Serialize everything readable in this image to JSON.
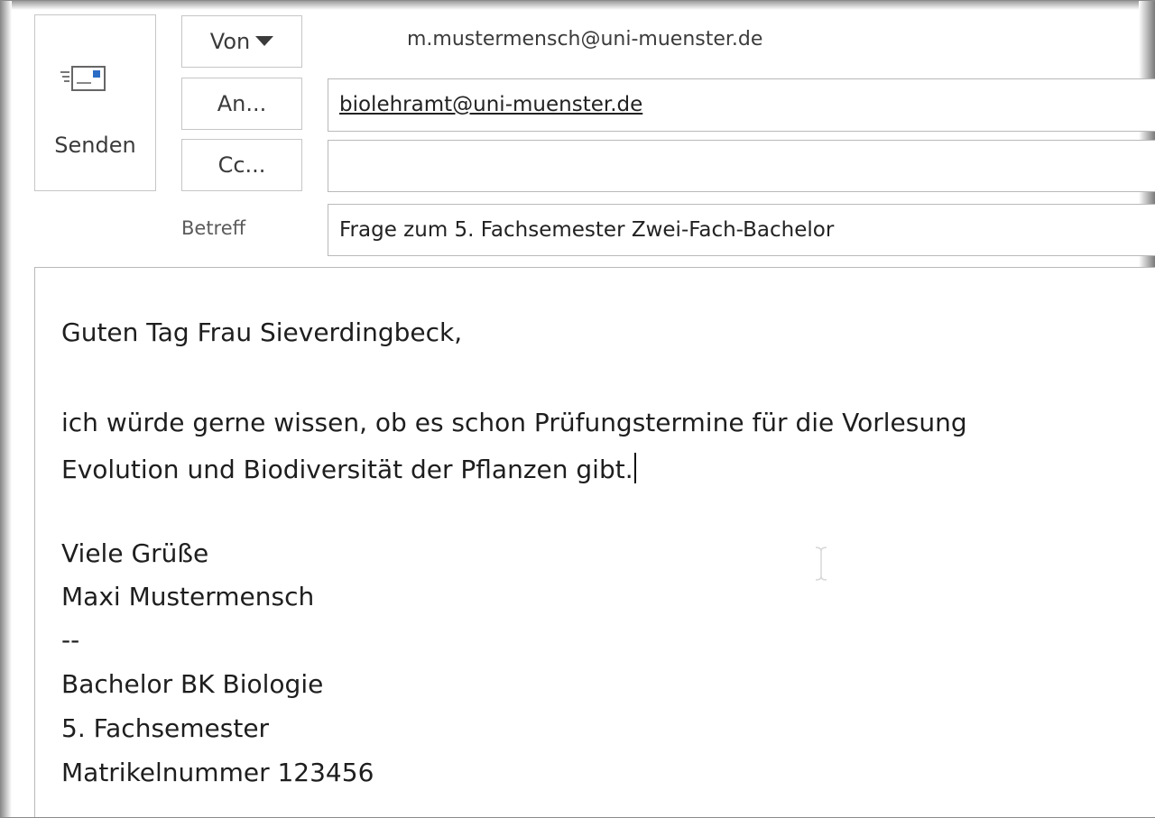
{
  "header": {
    "send_label": "Senden",
    "from_label": "Von",
    "to_label": "An...",
    "cc_label": "Cc...",
    "subject_label": "Betreff",
    "from_address": "m.mustermensch@uni-muenster.de",
    "to_address": "biolehramt@uni-muenster.de",
    "cc_value": "",
    "subject": "Frage zum 5. Fachsemester Zwei-Fach-Bachelor"
  },
  "body": {
    "lines": [
      "Guten Tag Frau Sieverdingbeck,",
      "ich würde gerne wissen, ob es schon Prüfungstermine für die Vorlesung",
      "Evolution und Biodiversität der Pflanzen gibt.",
      "Viele Grüße",
      "Maxi Mustermensch",
      "--",
      "Bachelor BK Biologie",
      "5. Fachsemester",
      "Matrikelnummer 123456"
    ]
  },
  "icons": {
    "send": "send-mail-icon",
    "from_dropdown": "chevron-down-icon",
    "text_cursor": "i-beam-cursor-icon"
  }
}
